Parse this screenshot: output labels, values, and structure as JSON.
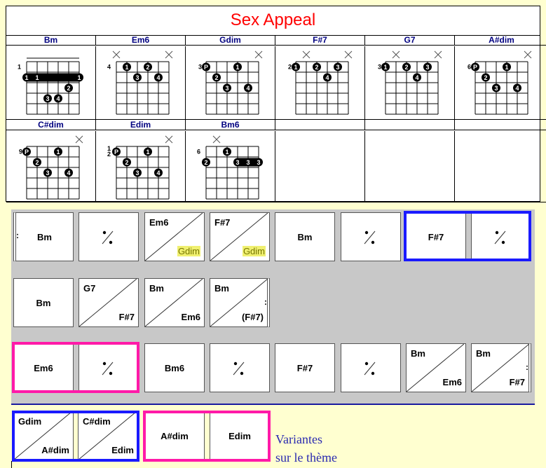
{
  "title": "Sex Appeal",
  "colors": {
    "title": "#ff0000",
    "chord_name": "#000080",
    "grid_bg": "#c8c8c8",
    "page_bg": "#ffffd0",
    "blue_box": "#1a1aff",
    "pink_box": "#ff1aa8",
    "highlight": "#f0f070"
  },
  "chords": [
    {
      "name": "Bm",
      "fret": "1",
      "nut": true,
      "muted": [],
      "dots": [
        [
          5,
          3,
          "2"
        ],
        [
          3,
          4,
          "3"
        ],
        [
          4,
          4,
          "4"
        ]
      ],
      "barres": [
        [
          1,
          6,
          2,
          [
            "1",
            "1",
            "",
            "",
            "",
            "1"
          ]
        ]
      ]
    },
    {
      "name": "Em6",
      "fret": "4",
      "muted": [
        1,
        6
      ],
      "dots": [
        [
          2,
          1,
          "1"
        ],
        [
          4,
          1,
          "2"
        ],
        [
          3,
          2,
          "3"
        ],
        [
          5,
          2,
          "4"
        ]
      ],
      "barres": []
    },
    {
      "name": "Gdim",
      "fret": "3",
      "muted": [
        6
      ],
      "dots": [
        [
          1,
          1,
          "P"
        ],
        [
          4,
          1,
          "1"
        ],
        [
          2,
          2,
          "2"
        ],
        [
          3,
          3,
          "3"
        ],
        [
          5,
          3,
          "4"
        ]
      ],
      "barres": []
    },
    {
      "name": "F#7",
      "fret": "2",
      "muted": [
        2,
        6
      ],
      "dots": [
        [
          1,
          1,
          "1"
        ],
        [
          3,
          1,
          "2"
        ],
        [
          5,
          1,
          "3"
        ],
        [
          4,
          2,
          "4"
        ]
      ],
      "barres": []
    },
    {
      "name": "G7",
      "fret": "3",
      "muted": [
        2,
        6
      ],
      "dots": [
        [
          1,
          1,
          "1"
        ],
        [
          3,
          1,
          "2"
        ],
        [
          5,
          1,
          "3"
        ],
        [
          4,
          2,
          "4"
        ]
      ],
      "barres": []
    },
    {
      "name": "A#dim",
      "fret": "6",
      "muted": [
        6
      ],
      "dots": [
        [
          1,
          1,
          "P"
        ],
        [
          4,
          1,
          "1"
        ],
        [
          2,
          2,
          "2"
        ],
        [
          3,
          3,
          "3"
        ],
        [
          5,
          3,
          "4"
        ]
      ],
      "barres": []
    },
    {
      "name": "C#dim",
      "fret": "9",
      "muted": [
        6
      ],
      "dots": [
        [
          1,
          1,
          "P"
        ],
        [
          4,
          1,
          "1"
        ],
        [
          2,
          2,
          "2"
        ],
        [
          3,
          3,
          "3"
        ],
        [
          5,
          3,
          "4"
        ]
      ],
      "barres": []
    },
    {
      "name": "Edim",
      "fret": "12",
      "muted": [
        6
      ],
      "dots": [
        [
          1,
          1,
          "P"
        ],
        [
          4,
          1,
          "1"
        ],
        [
          2,
          2,
          "2"
        ],
        [
          3,
          3,
          "3"
        ],
        [
          5,
          3,
          "4"
        ]
      ],
      "barres": []
    },
    {
      "name": "Bm6",
      "fret": "6",
      "muted": [
        2
      ],
      "dots": [
        [
          3,
          1,
          "1"
        ],
        [
          1,
          2,
          "2"
        ]
      ],
      "barres": [
        [
          4,
          6,
          2,
          [
            "3",
            "3",
            "3"
          ]
        ]
      ]
    }
  ],
  "grid_rows": [
    [
      {
        "type": "single",
        "chord": "Bm",
        "start_repeat": true
      },
      {
        "type": "repeat"
      },
      {
        "type": "split",
        "top": "Em6",
        "bottom": "Gdim",
        "bottom_highlight": true
      },
      {
        "type": "split",
        "top": "F#7",
        "bottom": "Gdim",
        "bottom_highlight": true
      },
      {
        "type": "single",
        "chord": "Bm"
      },
      {
        "type": "repeat"
      },
      {
        "type": "single",
        "chord": "F#7"
      },
      {
        "type": "repeat"
      }
    ],
    [
      {
        "type": "single",
        "chord": "Bm"
      },
      {
        "type": "split",
        "top": "G7",
        "bottom": "F#7"
      },
      {
        "type": "split",
        "top": "Bm",
        "bottom": "Em6"
      },
      {
        "type": "split",
        "top": "Bm",
        "bottom": "(F#7)",
        "end_repeat": true
      }
    ],
    [
      {
        "type": "single",
        "chord": "Em6"
      },
      {
        "type": "repeat"
      },
      {
        "type": "single",
        "chord": "Bm6"
      },
      {
        "type": "repeat"
      },
      {
        "type": "single",
        "chord": "F#7"
      },
      {
        "type": "repeat"
      },
      {
        "type": "split",
        "top": "Bm",
        "bottom": "Em6"
      },
      {
        "type": "split",
        "top": "Bm",
        "bottom": "F#7",
        "end_repeat": true
      }
    ]
  ],
  "variants": [
    {
      "type": "split",
      "top": "Gdim",
      "bottom": "A#dim"
    },
    {
      "type": "split",
      "top": "C#dim",
      "bottom": "Edim"
    },
    {
      "type": "single",
      "chord": "A#dim"
    },
    {
      "type": "single",
      "chord": "Edim"
    }
  ],
  "variants_label": [
    "Variantes",
    "sur le thème"
  ],
  "repeat_mark": ":"
}
